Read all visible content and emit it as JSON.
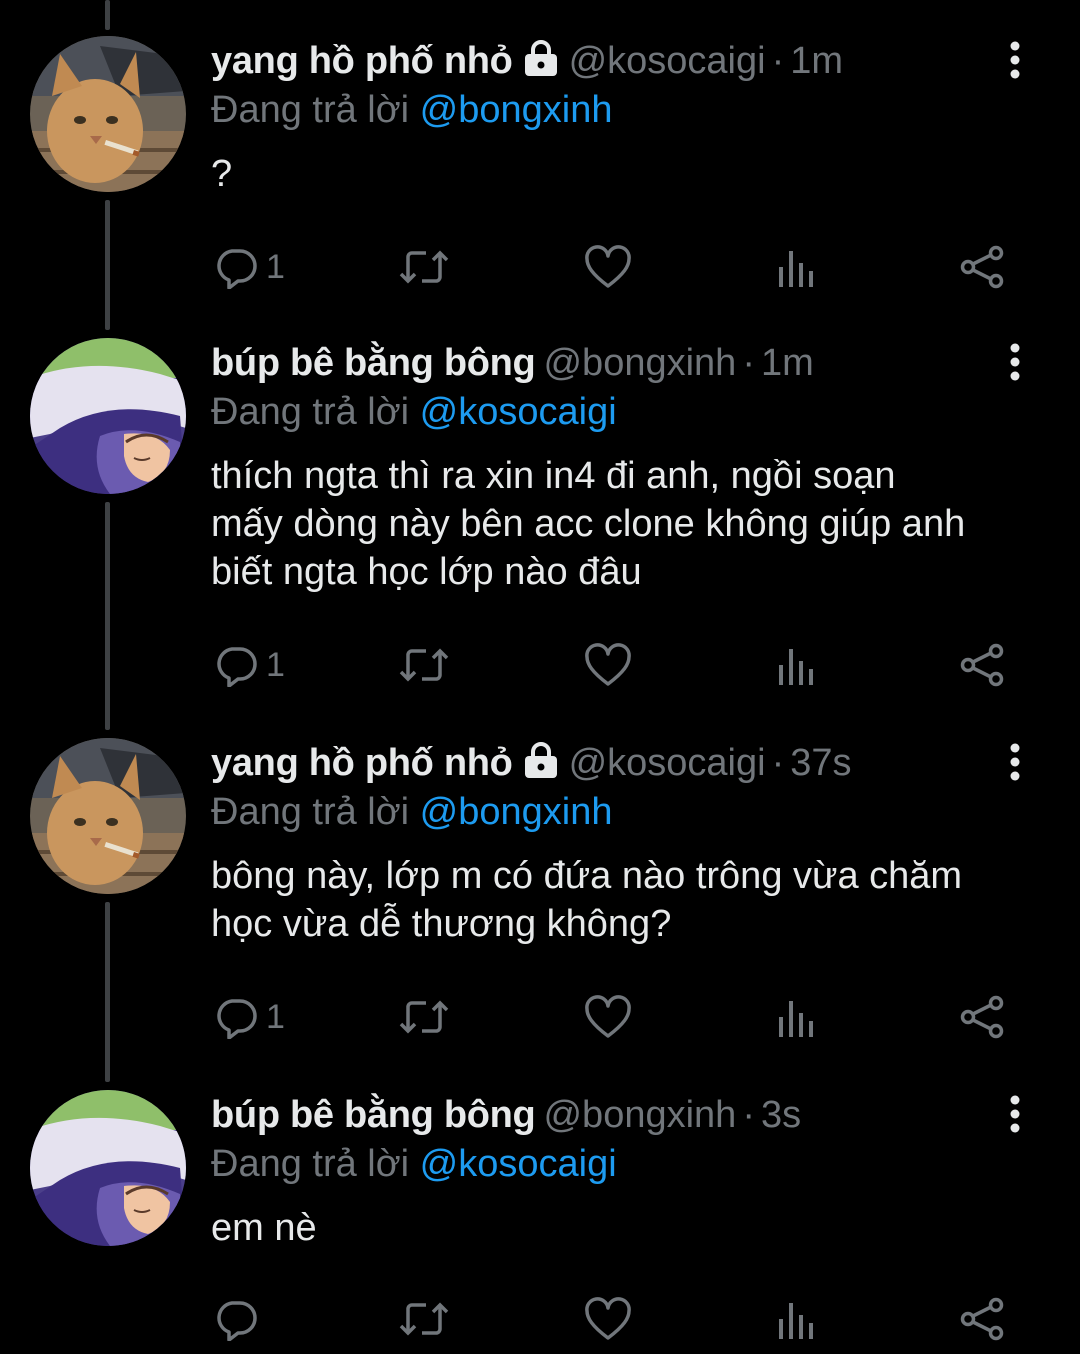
{
  "tweets": [
    {
      "name": "yang hồ phố nhỏ",
      "locked": true,
      "handle": "@kosocaigi",
      "separator": "·",
      "time": "1m",
      "reply_prefix": "Đang trả lời",
      "reply_to": "@bongxinh",
      "text": "?",
      "reply_count": "1",
      "avatar": "cat-avatar"
    },
    {
      "name": "búp bê bằng bông",
      "locked": false,
      "handle": "@bongxinh",
      "separator": "·",
      "time": "1m",
      "reply_prefix": "Đang trả lời",
      "reply_to": "@kosocaigi",
      "text": "thích ngta thì ra xin in4 đi anh, ngồi soạn\nmấy dòng này bên acc clone không giúp anh\nbiết ngta học lớp nào đâu",
      "reply_count": "1",
      "avatar": "sleeping-avatar"
    },
    {
      "name": "yang hồ phố nhỏ",
      "locked": true,
      "handle": "@kosocaigi",
      "separator": "·",
      "time": "37s",
      "reply_prefix": "Đang trả lời",
      "reply_to": "@bongxinh",
      "text": "bông này, lớp m có đứa nào trông vừa chăm\nhọc vừa dễ thương không?",
      "reply_count": "1",
      "avatar": "cat-avatar"
    },
    {
      "name": "búp bê bằng bông",
      "locked": false,
      "handle": "@bongxinh",
      "separator": "·",
      "time": "3s",
      "reply_prefix": "Đang trả lời",
      "reply_to": "@kosocaigi",
      "text": "em nè",
      "reply_count": "",
      "avatar": "sleeping-avatar"
    }
  ],
  "colors": {
    "background": "#000000",
    "text": "#e7e9ea",
    "muted": "#71767b",
    "accent": "#1d9bf0",
    "thread_line": "#3e4144"
  },
  "icons": [
    "lock-icon",
    "more-icon",
    "reply-icon",
    "retweet-icon",
    "like-icon",
    "views-icon",
    "share-icon"
  ]
}
